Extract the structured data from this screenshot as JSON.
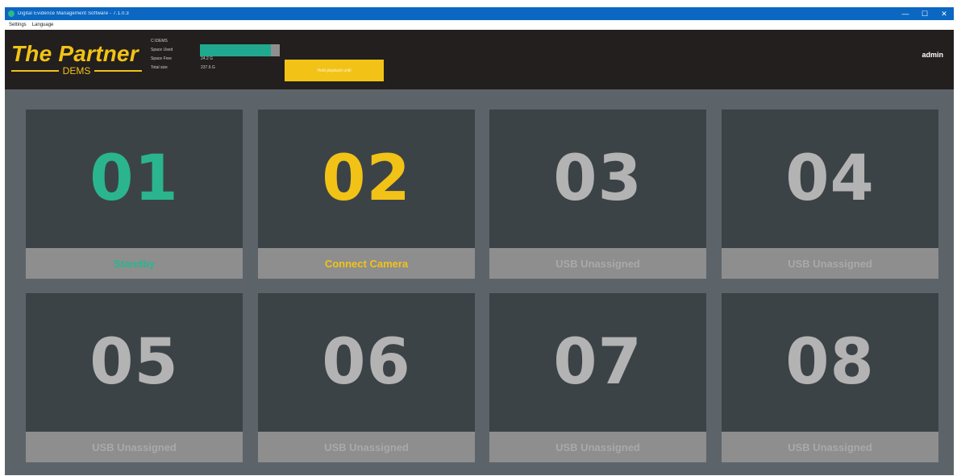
{
  "window": {
    "title": "Digital Evidence Management Software - 7.1.0.3",
    "controls": {
      "minimize": "—",
      "maximize": "☐",
      "close": "✕"
    }
  },
  "menu": {
    "items": [
      "Settings",
      "Language"
    ]
  },
  "header": {
    "logo": {
      "title": "The Partner",
      "subtitle": "DEMS"
    },
    "drive_label": "C:\\DEMS",
    "stats": [
      {
        "label": "Space Used",
        "value": ""
      },
      {
        "label": "Space Free",
        "value": "24.2 G"
      },
      {
        "label": "Total size",
        "value": "237.6 G"
      }
    ],
    "space_used_fraction": 0.89,
    "action_button": "Hold playback until",
    "user": "admin"
  },
  "colors": {
    "accent_green": "#2ab58e",
    "accent_yellow": "#f2c316",
    "inactive": "#b3b3b3"
  },
  "tiles": [
    {
      "number": "01",
      "status": "Standby"
    },
    {
      "number": "02",
      "status": "Connect Camera"
    },
    {
      "number": "03",
      "status": "USB Unassigned"
    },
    {
      "number": "04",
      "status": "USB Unassigned"
    },
    {
      "number": "05",
      "status": "USB Unassigned"
    },
    {
      "number": "06",
      "status": "USB Unassigned"
    },
    {
      "number": "07",
      "status": "USB Unassigned"
    },
    {
      "number": "08",
      "status": "USB Unassigned"
    }
  ]
}
